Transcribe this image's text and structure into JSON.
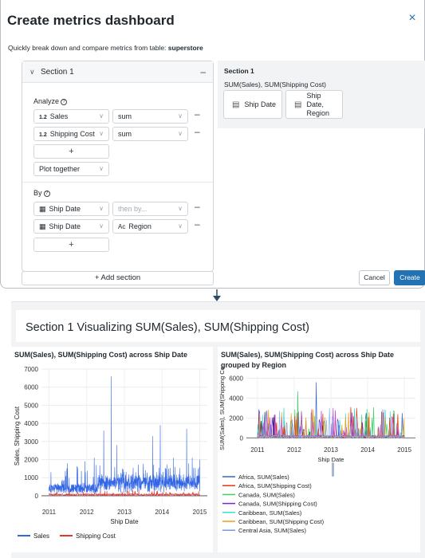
{
  "modal": {
    "title": "Create metrics dashboard",
    "subtitle_prefix": "Quickly break down and compare metrics from table: ",
    "table_name": "superstore",
    "section": {
      "name": "Section 1",
      "analyze_label": "Analyze",
      "metrics": [
        {
          "type_tag": "1.2",
          "column": "Sales",
          "agg": "sum"
        },
        {
          "type_tag": "1.2",
          "column": "Shipping Cost",
          "agg": "sum"
        }
      ],
      "add_metric_label": "+",
      "plot_mode": "Plot together",
      "by_label": "By",
      "breakdowns": [
        {
          "column": "Ship Date",
          "then_by": "then by...",
          "then_by_is_placeholder": true
        },
        {
          "column": "Ship Date",
          "then_by": "Region",
          "then_by_is_placeholder": false
        }
      ],
      "add_breakdown_label": "+"
    },
    "add_section_label": "+ Add section",
    "preview": {
      "title": "Section 1",
      "fields": "SUM(Sales), SUM(Shipping Cost)",
      "cards": [
        "Ship Date",
        "Ship Date, Region"
      ]
    },
    "cancel_label": "Cancel",
    "create_label": "Create",
    "close_icon": "×"
  },
  "dashboard": {
    "title": "Section 1 Visualizing SUM(Sales), SUM(Shipping Cost)",
    "panels": [
      {
        "title": "SUM(Sales), SUM(Shipping Cost) across Ship Date"
      },
      {
        "title": "SUM(Sales), SUM(Shipping Cost) across Ship Date grouped by Region"
      }
    ]
  },
  "chart_data": [
    {
      "type": "line",
      "title": "SUM(Sales), SUM(Shipping Cost) across Ship Date",
      "xlabel": "Ship Date",
      "ylabel": "Sales, Shipping Cost",
      "xlim": [
        2010.8,
        2015.2
      ],
      "ylim": [
        -400,
        7000
      ],
      "x_ticks": [
        "2011",
        "2012",
        "2013",
        "2014",
        "2015"
      ],
      "y_ticks": [
        0,
        1000,
        2000,
        3000,
        4000,
        5000,
        6000,
        7000
      ],
      "grid": true,
      "legend": "bottom",
      "series": [
        {
          "name": "Sales",
          "color": "#3366e6",
          "peaks": [
            [
              2011.05,
              1300
            ],
            [
              2011.35,
              900
            ],
            [
              2011.75,
              900
            ],
            [
              2011.95,
              1900
            ],
            [
              2012.2,
              2100
            ],
            [
              2012.3,
              1000
            ],
            [
              2012.45,
              3600
            ],
            [
              2012.55,
              1100
            ],
            [
              2012.65,
              6600
            ],
            [
              2012.8,
              2800
            ],
            [
              2012.95,
              1500
            ],
            [
              2013.3,
              1300
            ],
            [
              2013.5,
              1500
            ],
            [
              2013.75,
              3300
            ],
            [
              2013.85,
              1300
            ],
            [
              2013.95,
              3900
            ],
            [
              2014.1,
              1500
            ],
            [
              2014.3,
              2100
            ],
            [
              2014.45,
              1200
            ],
            [
              2014.65,
              3700
            ],
            [
              2014.8,
              2100
            ],
            [
              2014.95,
              1500
            ],
            [
              2015.0,
              2000
            ]
          ]
        },
        {
          "name": "Shipping Cost",
          "color": "#e63333"
        }
      ]
    },
    {
      "type": "line",
      "title": "SUM(Sales), SUM(Shipping Cost) across Ship Date grouped by Region",
      "xlabel": "Ship Date",
      "ylabel": "SUM(Sales), SUM(Shipping Co",
      "xlim": [
        2010.7,
        2015.3
      ],
      "ylim": [
        -300,
        6200
      ],
      "x_ticks": [
        "2011",
        "2012",
        "2013",
        "2014",
        "2015"
      ],
      "y_ticks": [
        0,
        2000,
        4000,
        6000
      ],
      "grid": true,
      "legend": "bottom",
      "series": [
        {
          "name": "Africa, SUM(Sales)",
          "color": "#3366cc"
        },
        {
          "name": "Africa, SUM(Shipping Cost)",
          "color": "#dc3912"
        },
        {
          "name": "Canada, SUM(Sales)",
          "color": "#3fd06b"
        },
        {
          "name": "Canada, SUM(Shipping Cost)",
          "color": "#6a2bd1"
        },
        {
          "name": "Caribbean, SUM(Sales)",
          "color": "#38d9d9"
        },
        {
          "name": "Caribbean, SUM(Shipping Cost)",
          "color": "#e6a019"
        },
        {
          "name": "Central Asia, SUM(Sales)",
          "color": "#6f9be8"
        }
      ]
    }
  ]
}
